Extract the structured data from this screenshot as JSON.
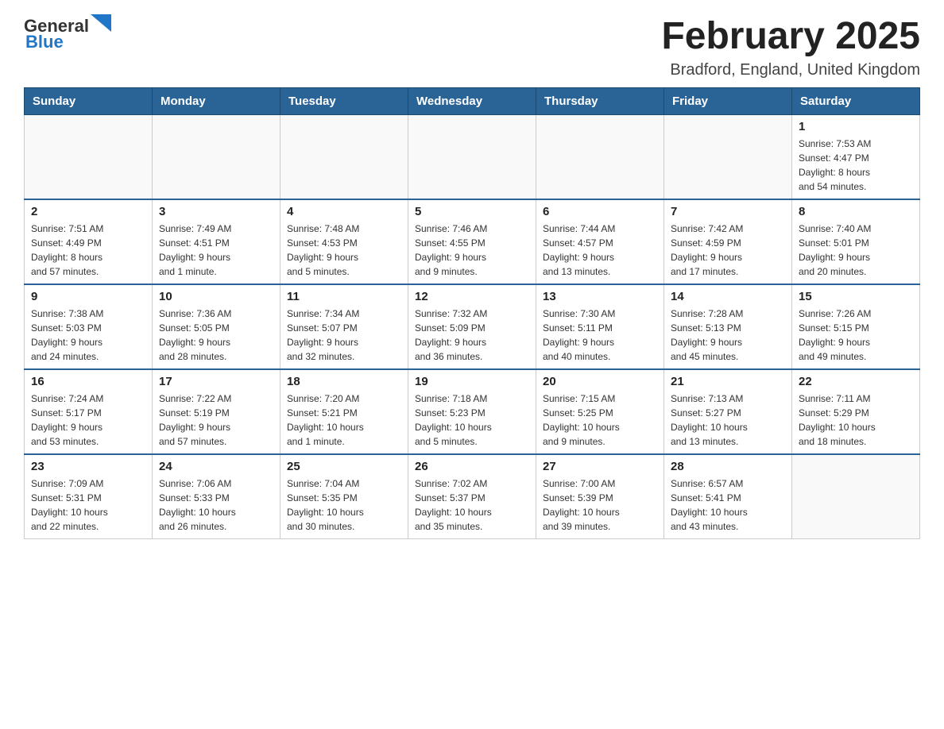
{
  "header": {
    "logo": {
      "general": "General",
      "blue": "Blue"
    },
    "title": "February 2025",
    "location": "Bradford, England, United Kingdom"
  },
  "calendar": {
    "days_of_week": [
      "Sunday",
      "Monday",
      "Tuesday",
      "Wednesday",
      "Thursday",
      "Friday",
      "Saturday"
    ],
    "weeks": [
      [
        {
          "day": "",
          "info": ""
        },
        {
          "day": "",
          "info": ""
        },
        {
          "day": "",
          "info": ""
        },
        {
          "day": "",
          "info": ""
        },
        {
          "day": "",
          "info": ""
        },
        {
          "day": "",
          "info": ""
        },
        {
          "day": "1",
          "info": "Sunrise: 7:53 AM\nSunset: 4:47 PM\nDaylight: 8 hours\nand 54 minutes."
        }
      ],
      [
        {
          "day": "2",
          "info": "Sunrise: 7:51 AM\nSunset: 4:49 PM\nDaylight: 8 hours\nand 57 minutes."
        },
        {
          "day": "3",
          "info": "Sunrise: 7:49 AM\nSunset: 4:51 PM\nDaylight: 9 hours\nand 1 minute."
        },
        {
          "day": "4",
          "info": "Sunrise: 7:48 AM\nSunset: 4:53 PM\nDaylight: 9 hours\nand 5 minutes."
        },
        {
          "day": "5",
          "info": "Sunrise: 7:46 AM\nSunset: 4:55 PM\nDaylight: 9 hours\nand 9 minutes."
        },
        {
          "day": "6",
          "info": "Sunrise: 7:44 AM\nSunset: 4:57 PM\nDaylight: 9 hours\nand 13 minutes."
        },
        {
          "day": "7",
          "info": "Sunrise: 7:42 AM\nSunset: 4:59 PM\nDaylight: 9 hours\nand 17 minutes."
        },
        {
          "day": "8",
          "info": "Sunrise: 7:40 AM\nSunset: 5:01 PM\nDaylight: 9 hours\nand 20 minutes."
        }
      ],
      [
        {
          "day": "9",
          "info": "Sunrise: 7:38 AM\nSunset: 5:03 PM\nDaylight: 9 hours\nand 24 minutes."
        },
        {
          "day": "10",
          "info": "Sunrise: 7:36 AM\nSunset: 5:05 PM\nDaylight: 9 hours\nand 28 minutes."
        },
        {
          "day": "11",
          "info": "Sunrise: 7:34 AM\nSunset: 5:07 PM\nDaylight: 9 hours\nand 32 minutes."
        },
        {
          "day": "12",
          "info": "Sunrise: 7:32 AM\nSunset: 5:09 PM\nDaylight: 9 hours\nand 36 minutes."
        },
        {
          "day": "13",
          "info": "Sunrise: 7:30 AM\nSunset: 5:11 PM\nDaylight: 9 hours\nand 40 minutes."
        },
        {
          "day": "14",
          "info": "Sunrise: 7:28 AM\nSunset: 5:13 PM\nDaylight: 9 hours\nand 45 minutes."
        },
        {
          "day": "15",
          "info": "Sunrise: 7:26 AM\nSunset: 5:15 PM\nDaylight: 9 hours\nand 49 minutes."
        }
      ],
      [
        {
          "day": "16",
          "info": "Sunrise: 7:24 AM\nSunset: 5:17 PM\nDaylight: 9 hours\nand 53 minutes."
        },
        {
          "day": "17",
          "info": "Sunrise: 7:22 AM\nSunset: 5:19 PM\nDaylight: 9 hours\nand 57 minutes."
        },
        {
          "day": "18",
          "info": "Sunrise: 7:20 AM\nSunset: 5:21 PM\nDaylight: 10 hours\nand 1 minute."
        },
        {
          "day": "19",
          "info": "Sunrise: 7:18 AM\nSunset: 5:23 PM\nDaylight: 10 hours\nand 5 minutes."
        },
        {
          "day": "20",
          "info": "Sunrise: 7:15 AM\nSunset: 5:25 PM\nDaylight: 10 hours\nand 9 minutes."
        },
        {
          "day": "21",
          "info": "Sunrise: 7:13 AM\nSunset: 5:27 PM\nDaylight: 10 hours\nand 13 minutes."
        },
        {
          "day": "22",
          "info": "Sunrise: 7:11 AM\nSunset: 5:29 PM\nDaylight: 10 hours\nand 18 minutes."
        }
      ],
      [
        {
          "day": "23",
          "info": "Sunrise: 7:09 AM\nSunset: 5:31 PM\nDaylight: 10 hours\nand 22 minutes."
        },
        {
          "day": "24",
          "info": "Sunrise: 7:06 AM\nSunset: 5:33 PM\nDaylight: 10 hours\nand 26 minutes."
        },
        {
          "day": "25",
          "info": "Sunrise: 7:04 AM\nSunset: 5:35 PM\nDaylight: 10 hours\nand 30 minutes."
        },
        {
          "day": "26",
          "info": "Sunrise: 7:02 AM\nSunset: 5:37 PM\nDaylight: 10 hours\nand 35 minutes."
        },
        {
          "day": "27",
          "info": "Sunrise: 7:00 AM\nSunset: 5:39 PM\nDaylight: 10 hours\nand 39 minutes."
        },
        {
          "day": "28",
          "info": "Sunrise: 6:57 AM\nSunset: 5:41 PM\nDaylight: 10 hours\nand 43 minutes."
        },
        {
          "day": "",
          "info": ""
        }
      ]
    ]
  }
}
